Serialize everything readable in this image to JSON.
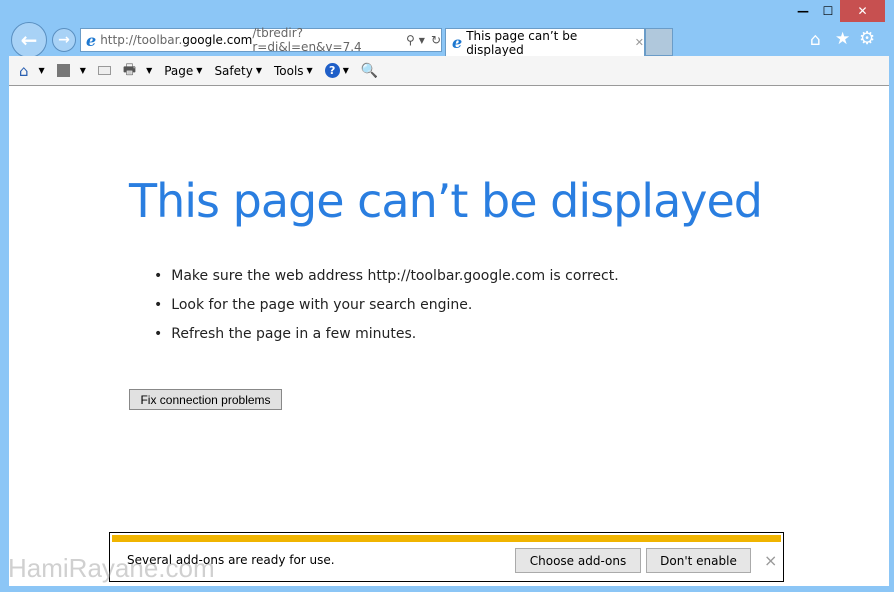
{
  "window": {
    "minimize": "—",
    "maximize": "☐",
    "close": "✕"
  },
  "address_bar": {
    "url_prefix": "http://toolbar.",
    "url_domain": "google.com",
    "url_suffix": "/tbredir?r=di&l=en&v=7.4"
  },
  "tab": {
    "title": "This page can’t be displayed",
    "close": "✕"
  },
  "toolbar": {
    "page": "Page",
    "safety": "Safety",
    "tools": "Tools"
  },
  "page": {
    "heading": "This page can’t be displayed",
    "bullets": [
      "Make sure the web address http://toolbar.google.com is correct.",
      "Look for the page with your search engine.",
      "Refresh the page in a few minutes."
    ],
    "fix_button": "Fix connection problems"
  },
  "notification": {
    "message": "Several add-ons are ready for use.",
    "choose": "Choose add-ons",
    "dont_enable": "Don't enable",
    "close": "×",
    "accent": "#f0b400"
  },
  "watermark": "HamiRayane.com"
}
